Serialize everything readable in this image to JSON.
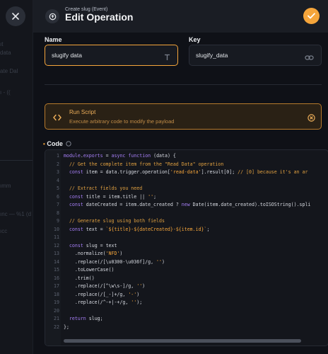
{
  "header": {
    "subtitle": "Create slug (Event)",
    "title": "Edit Operation"
  },
  "fields": {
    "name_label": "Name",
    "name_value": "slugify data",
    "key_label": "Key",
    "key_value": "slugify_data"
  },
  "notice": {
    "title": "Run Script",
    "description": "Execute arbitrary code to modify the payload"
  },
  "code": {
    "label": "Code",
    "lines": [
      "module.exports = async function (data) {",
      "  // Get the complete item from the \"Read Data\" operation",
      "  const item = data.$trigger.operation['read-data'].result[0]; // [0] because it's an ar",
      "",
      "  // Extract fields you need",
      "  const title = item.title || '';",
      "  const dateCreated = item.date_created ? new Date(item.date_created).toISOString().spli",
      "",
      "  // Generate slug using both fields",
      "  const text = `${title}-${dateCreated}-${item.id}`;",
      "",
      "  const slug = text",
      "    .normalize('NFD')",
      "    .replace(/[\\u0300-\\u036f]/g, '')",
      "    .toLowerCase()",
      "    .trim()",
      "    .replace(/[^\\w\\s-]/g, '')",
      "    .replace(/[_-]+/g, '-')",
      "    .replace(/^-+|-+$/g, '');",
      "",
      "  return slug;",
      "};"
    ]
  },
  "background": {
    "texts": [
      "ıt",
      "data",
      "ate Dal",
      "ı - ((",
      "ımm",
      "ınc — %1 (d",
      "ıcc"
    ]
  },
  "colors": {
    "accent": "#f5a53b",
    "keyword": "#a57ef5"
  }
}
